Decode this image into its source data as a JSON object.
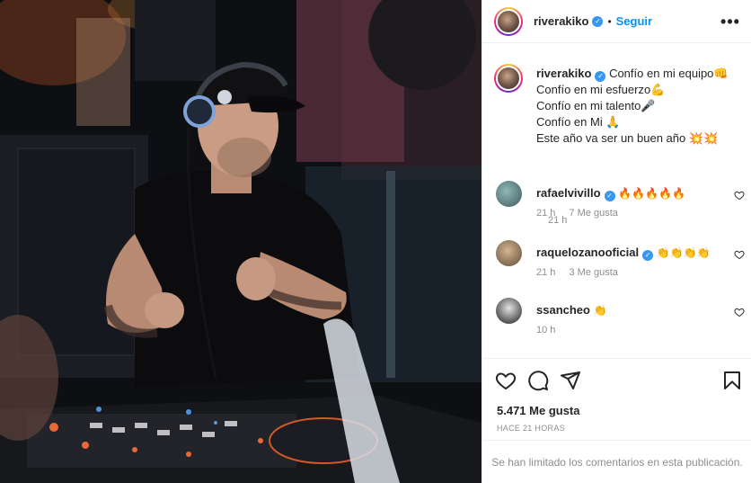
{
  "post": {
    "username": "riverakiko",
    "follow_label": "Seguir",
    "separator": "•",
    "more_label": "•••",
    "caption": "Confío en mi equipo👊\nConfío en mi esfuerzo💪\nConfío en mi talento🎤\nConfío en Mi 🙏\nEste año va ser un buen año 💥💥",
    "caption_time": "21 h",
    "likes": "5.471 Me gusta",
    "posted": "HACE 21 HORAS",
    "comments_limited": "Se han limitado los comentarios en esta publicación."
  },
  "comments": [
    {
      "user": "rafaelvivillo",
      "text": "🔥🔥🔥🔥🔥",
      "time": "21 h",
      "likes": "7 Me gusta",
      "verified": true,
      "avatar_color": "#5b7f86"
    },
    {
      "user": "raquelozanooficial",
      "text": "👏👏👏👏",
      "time": "21 h",
      "likes": "3 Me gusta",
      "verified": true,
      "avatar_color": "#a58a6a"
    },
    {
      "user": "ssancheo",
      "text": "👏",
      "time": "10 h",
      "likes": "",
      "verified": false,
      "avatar_color": "#3a3a3a"
    }
  ],
  "colors": {
    "accent": "#0095f6",
    "verified": "#3897f0",
    "muted": "#8e8e8e",
    "text": "#262626"
  },
  "icons": {
    "like": "heart-icon",
    "comment": "comment-icon",
    "share": "send-icon",
    "save": "bookmark-icon",
    "more": "more-options-icon"
  }
}
